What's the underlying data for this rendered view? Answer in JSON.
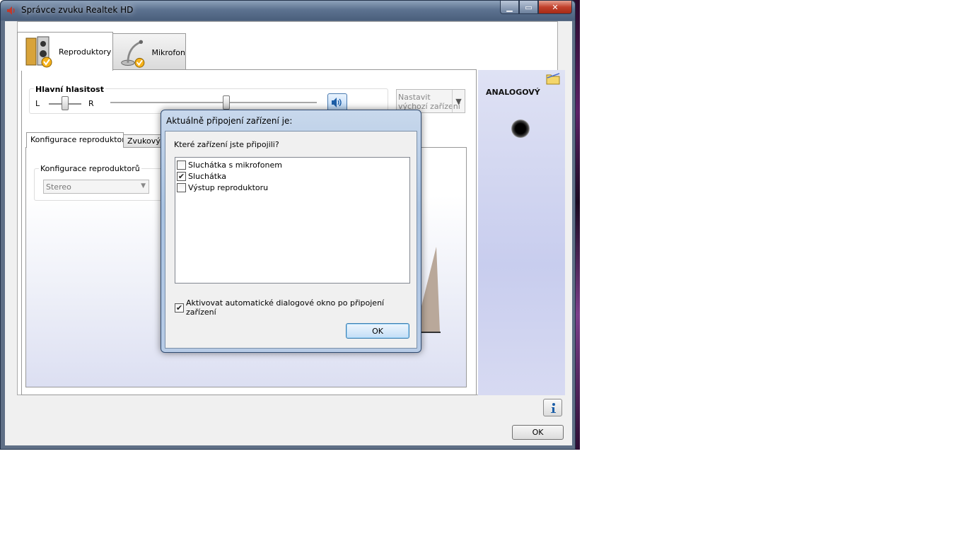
{
  "window": {
    "title": "Správce zvuku Realtek HD",
    "icon": "speaker-icon"
  },
  "device_tabs": [
    {
      "label": "Reproduktory",
      "icon": "speakers-icon",
      "active": true
    },
    {
      "label": "Mikrofon",
      "icon": "microphone-icon",
      "active": false
    }
  ],
  "master_volume": {
    "title": "Hlavní hlasitost",
    "left_label": "L",
    "right_label": "R",
    "balance": 0.5,
    "volume": 0.56
  },
  "default_device": {
    "line1": "Nastavit",
    "line2": "výchozí zařízení"
  },
  "sub_tabs": [
    {
      "label": "Konfigurace reproduktorů",
      "active": true
    },
    {
      "label": "Zvukový e",
      "active": false
    }
  ],
  "speaker_config": {
    "group_title": "Konfigurace reproduktorů",
    "selected": "Stereo"
  },
  "analog": {
    "title": "ANALOGOVÝ"
  },
  "main_ok": "OK",
  "dialog": {
    "title": "Aktuálně připojení zařízení je:",
    "question": "Které zařízení jste připojili?",
    "options": [
      {
        "label": "Sluchátka s mikrofonem",
        "checked": false
      },
      {
        "label": "Sluchátka",
        "checked": true
      },
      {
        "label": "Výstup reproduktoru",
        "checked": false
      }
    ],
    "auto_label": "Aktivovat automatické dialogové okno po připojení zařízení",
    "auto_checked": true,
    "ok": "OK"
  },
  "colors": {
    "titlebar": "#5d7290",
    "close": "#c2412c",
    "analog_panel": "#c8cdee"
  }
}
